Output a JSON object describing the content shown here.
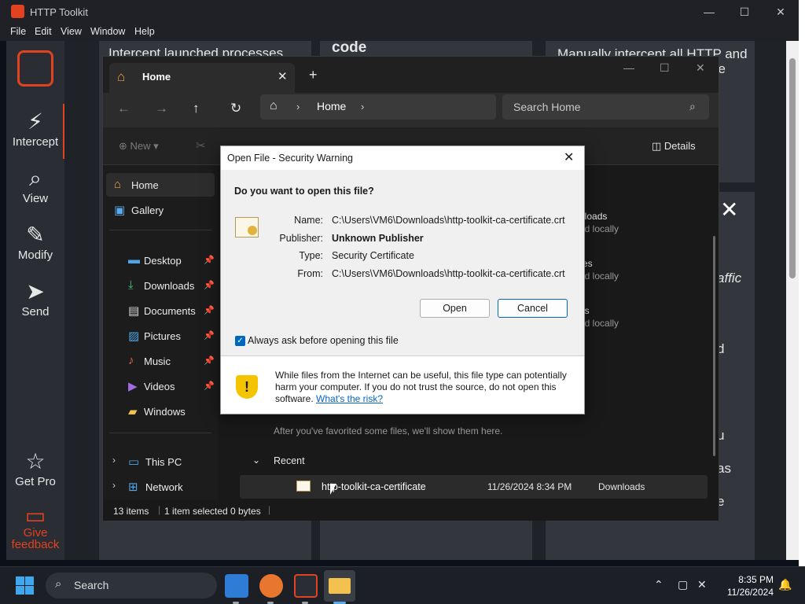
{
  "htk": {
    "title": "HTTP Toolkit",
    "menu": [
      "File",
      "Edit",
      "View",
      "Window",
      "Help"
    ],
    "nav": {
      "intercept": "Intercept",
      "view": "View",
      "modify": "Modify",
      "send": "Send",
      "get_pro": "Get Pro",
      "feedback_line1": "Give",
      "feedback_line2": "feedback"
    },
    "cards": {
      "intercept_launched": "Intercept launched processes",
      "code": "code",
      "manually_line1": "Manually intercept all HTTP and",
      "manually_line2": "ne",
      "affic": "affic",
      "d": "d",
      "u": "u",
      "as": "as",
      "e": "e"
    },
    "close_glyph": "✕"
  },
  "explorer": {
    "tab_label": "Home",
    "address_home": "Home",
    "search_placeholder": "Search Home",
    "toolbar_new": "New",
    "toolbar_details": "Details",
    "nav_items": [
      {
        "label": "Home"
      },
      {
        "label": "Gallery"
      },
      {
        "label": "Desktop"
      },
      {
        "label": "Downloads"
      },
      {
        "label": "Documents"
      },
      {
        "label": "Pictures"
      },
      {
        "label": "Music"
      },
      {
        "label": "Videos"
      },
      {
        "label": "Windows"
      },
      {
        "label": "This PC"
      },
      {
        "label": "Network"
      }
    ],
    "content": {
      "quick1_name": "nloads",
      "quick1_sub": "ed locally",
      "quick2_name": "res",
      "quick2_sub": "ed locally",
      "quick3_name": "os",
      "quick3_sub": "ed locally",
      "favorites_hint": "After you've favorited some files, we'll show them here.",
      "recent_header": "Recent",
      "recent_file": {
        "name": "http-toolkit-ca-certificate",
        "date": "11/26/2024 8:34 PM",
        "location": "Downloads"
      }
    },
    "status": {
      "items": "13 items",
      "selected": "1 item selected",
      "bytes": "0 bytes"
    }
  },
  "dialog": {
    "title": "Open File - Security Warning",
    "question": "Do you want to open this file?",
    "name_label": "Name:",
    "name_value": "C:\\Users\\VM6\\Downloads\\http-toolkit-ca-certificate.crt",
    "publisher_label": "Publisher:",
    "publisher_value": "Unknown Publisher",
    "type_label": "Type:",
    "type_value": "Security Certificate",
    "from_label": "From:",
    "from_value": "C:\\Users\\VM6\\Downloads\\http-toolkit-ca-certificate.crt",
    "open_button": "Open",
    "cancel_button": "Cancel",
    "always_ask_label": "Always ask before opening this file",
    "always_ask_checked": true,
    "warning_text": "While files from the Internet can be useful, this file type can potentially harm your computer. If you do not trust the source, do not open this software.",
    "risk_link": "What's the risk?"
  },
  "taskbar": {
    "search_label": "Search",
    "time": "8:35 PM",
    "date": "11/26/2024"
  },
  "colors": {
    "htk_accent": "#e1421f",
    "link": "#0066cc",
    "dialog_focus": "#0067c0"
  }
}
